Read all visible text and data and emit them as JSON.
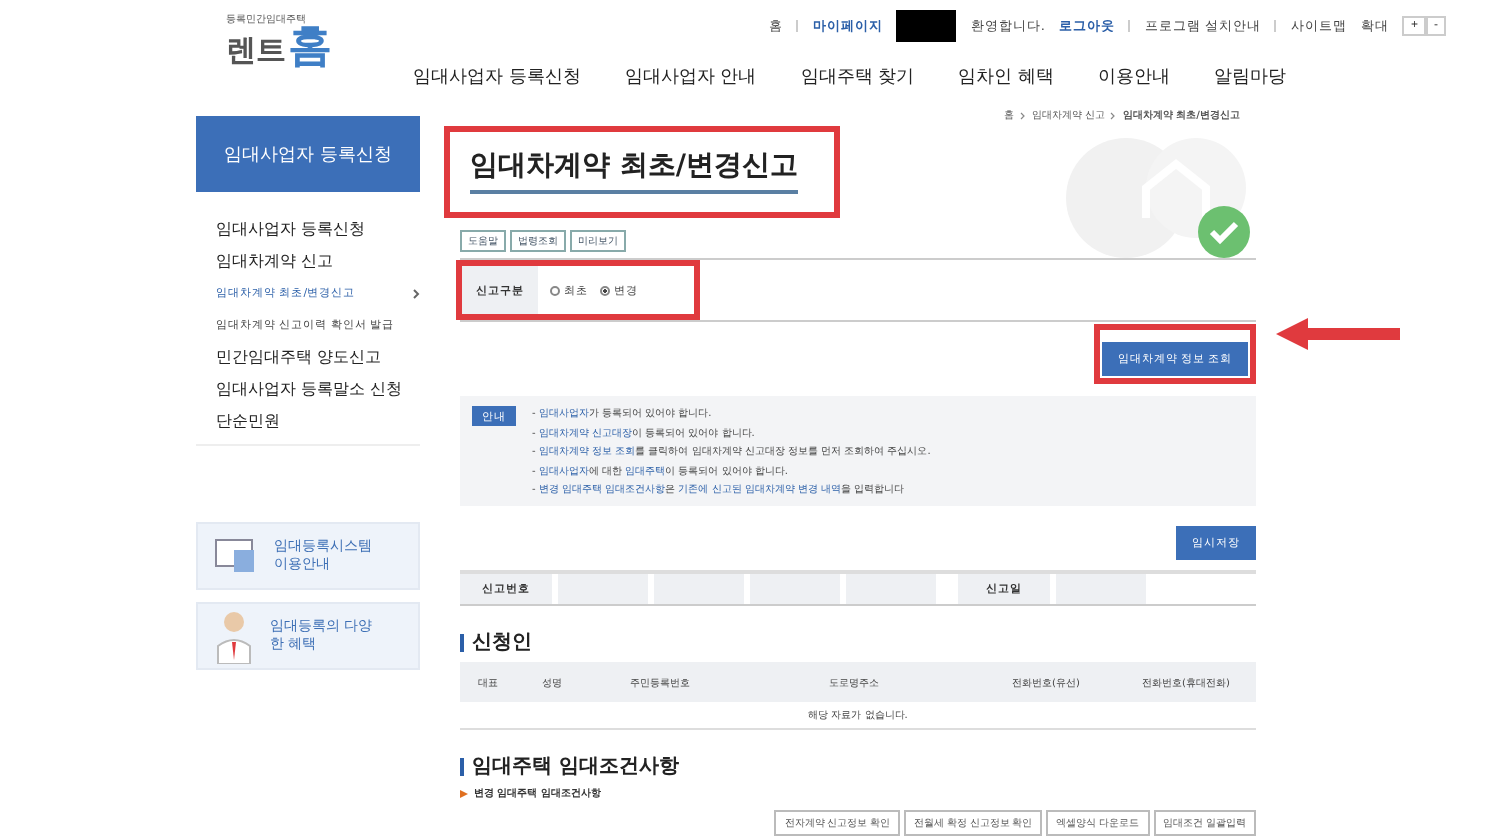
{
  "logo": {
    "tagline": "등록민간임대주택",
    "word_1": "렌트",
    "word_2": "홈"
  },
  "top_links": [
    {
      "label": "홈",
      "kind": "link"
    },
    {
      "label": "마이페이지",
      "kind": "accent_link"
    },
    {
      "kind": "redacted"
    },
    {
      "label": "환영합니다.",
      "kind": "text"
    },
    {
      "label": "로그아웃",
      "kind": "accent_link"
    },
    {
      "label": "프로그램 설치안내",
      "kind": "link"
    },
    {
      "label": "사이트맵",
      "kind": "link"
    },
    {
      "label": "확대",
      "kind": "text"
    }
  ],
  "zoom_buttons": [
    "+",
    "-"
  ],
  "nav": [
    "임대사업자 등록신청",
    "임대사업자 안내",
    "임대주택 찾기",
    "임차인 혜택",
    "이용안내",
    "알림마당"
  ],
  "sidebar": {
    "title": "임대사업자 등록신청",
    "items": [
      {
        "label": "임대사업자 등록신청",
        "selected": false
      },
      {
        "label": "임대차계약 신고",
        "selected": false,
        "children": [
          {
            "label": "임대차계약 최초/변경신고",
            "selected": true
          },
          {
            "label": "임대차계약 신고이력 확인서 발급",
            "selected": false
          }
        ]
      },
      {
        "label": "민간임대주택 양도신고",
        "selected": false
      },
      {
        "label": "임대사업자 등록말소 신청",
        "selected": false
      },
      {
        "label": "단순민원",
        "selected": false
      }
    ],
    "banners": [
      {
        "label": "임대등록시스템 이용안내",
        "kind": "guide"
      },
      {
        "label": "임대등록의 다양한 혜택",
        "kind": "benefit"
      }
    ]
  },
  "breadcrumb": [
    "홈",
    "임대차계약 신고",
    "임대차계약 최초/변경신고"
  ],
  "page_title": "임대차계약 최초/변경신고",
  "tool_buttons": [
    "도움말",
    "법령조회",
    "미리보기"
  ],
  "report_type": {
    "label": "신고구분",
    "options": [
      {
        "label": "최초",
        "selected": false
      },
      {
        "label": "변경",
        "selected": true
      }
    ]
  },
  "lookup_button": "임대차계약 정보 조회",
  "guide": {
    "tag": "안내",
    "lines": [
      "- **임대사업자**가 등록되어 있어야 합니다.",
      "- **임대차계약 신고대장**이 등록되어 있어야 합니다.",
      "- **임대차계약 정보 조회**를 클릭하여 임대차계약 신고대장 정보를 먼저 조회하여 주십시오.",
      "- **임대사업자**에 대한 **임대주택**이 등록되어 있어야 합니다.",
      "- **변경 임대주택 임대조건사항**은 **기존에 신고된 임대차계약 변경 내역**을 입력합니다"
    ]
  },
  "save_button": "임시저장",
  "report_row": {
    "number_label": "신고번호",
    "date_label": "신고일"
  },
  "applicant": {
    "heading": "신청인",
    "columns": [
      "대표",
      "성명",
      "주민등록번호",
      "도로명주소",
      "전화번호(유선)",
      "전화번호(휴대전화)"
    ],
    "empty_message": "해당 자료가 없습니다."
  },
  "conditions": {
    "heading": "임대주택 임대조건사항",
    "subheading": "변경 임대주택 임대조건사항",
    "buttons": [
      "전자계약 신고정보 확인",
      "전월세 확정 신고정보 확인",
      "엑셀양식 다운로드",
      "임대조건 일괄입력"
    ]
  }
}
